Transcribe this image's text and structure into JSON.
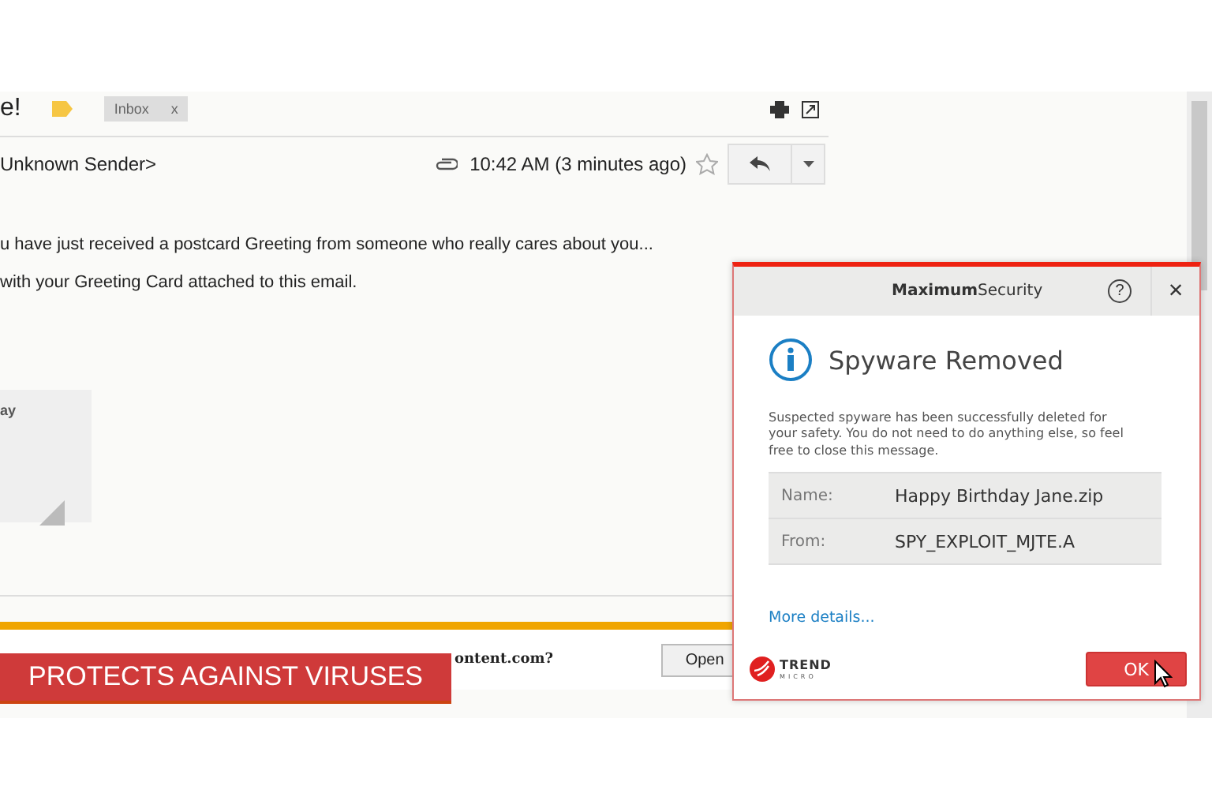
{
  "email": {
    "subject": "e!",
    "label": "Inbox",
    "label_remove": "x",
    "sender": "Unknown Sender>",
    "time": "10:42 AM (3 minutes ago)",
    "starred": false,
    "body": [
      "u have just received a postcard Greeting from someone who really cares about you...",
      "with your Greeting Card attached to this email."
    ],
    "attachment_card": "ay"
  },
  "download_bar": {
    "question": "ontent.com?",
    "button": "Open"
  },
  "banner": "PROTECTS AGAINST VIRUSES",
  "dialog": {
    "title_bold": "Maximum",
    "title_rest": "Security",
    "help": "?",
    "close": "×",
    "heading": "Spyware Removed",
    "message": "Suspected spyware has been successfully deleted for your safety. You do not need to do anything else, so feel free to close this message.",
    "details": [
      {
        "label": "Name:",
        "value": "Happy Birthday Jane.zip"
      },
      {
        "label": "From:",
        "value": "SPY_EXPLOIT_MJTE.A"
      }
    ],
    "link": "More details...",
    "logo_top": "TREND",
    "logo_bottom": "MICRO",
    "ok": "OK"
  }
}
